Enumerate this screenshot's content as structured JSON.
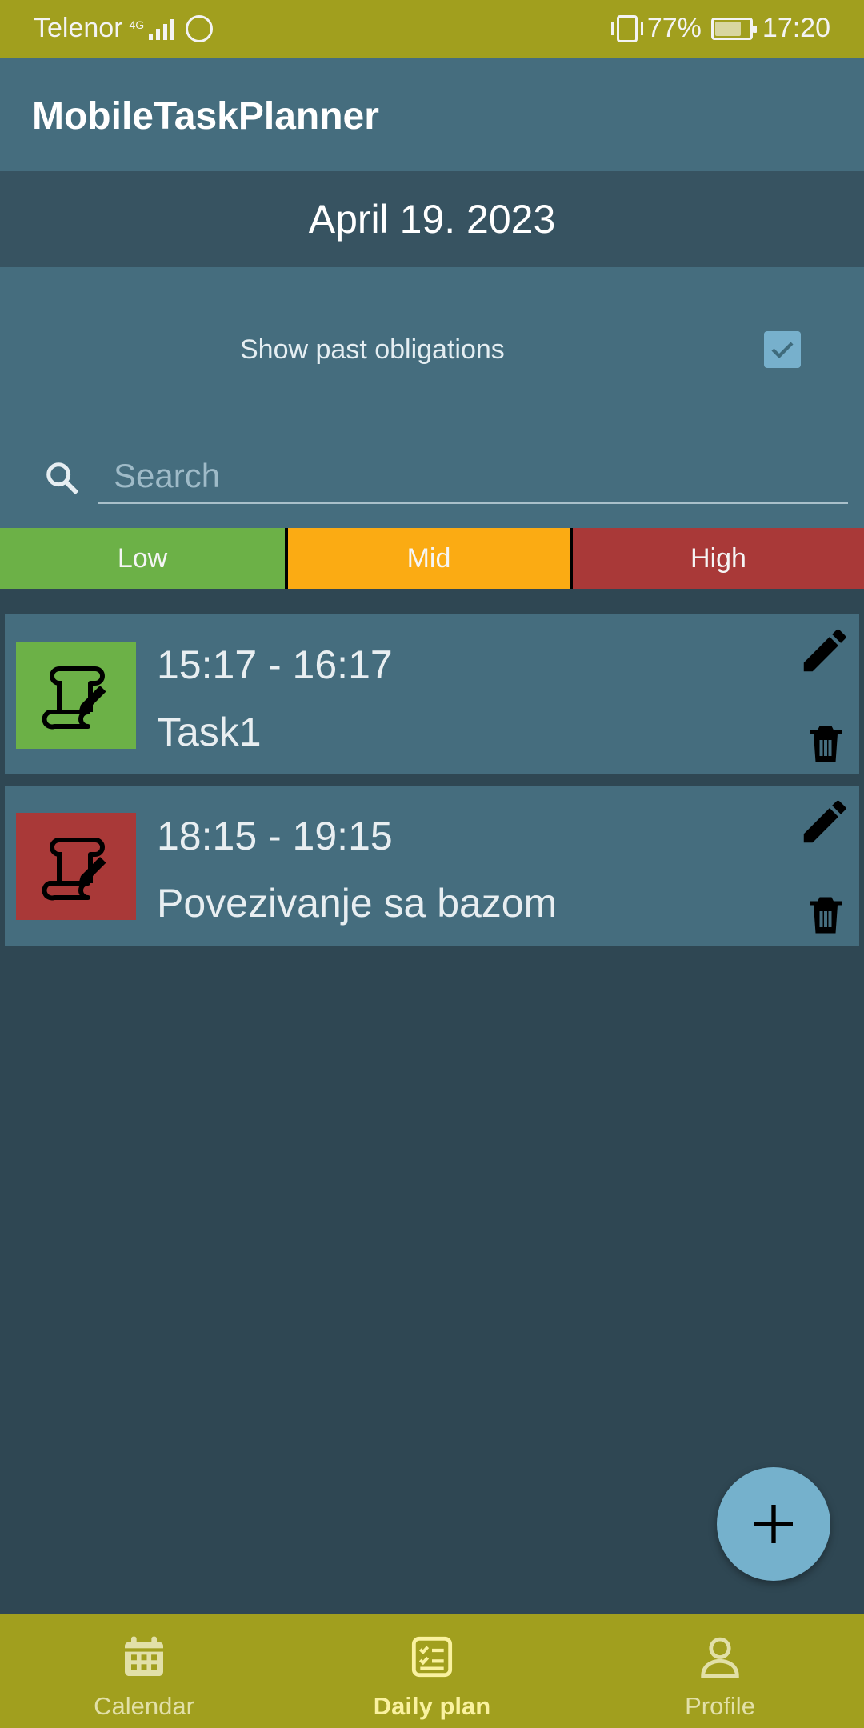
{
  "status_bar": {
    "carrier": "Telenor",
    "network": "4G",
    "battery_percent": "77%",
    "battery_level": 0.77,
    "time": "17:20"
  },
  "app": {
    "title": "MobileTaskPlanner",
    "date": "April 19. 2023"
  },
  "filters": {
    "show_past_label": "Show past obligations",
    "show_past_checked": true,
    "search_placeholder": "Search",
    "search_value": "",
    "priorities": [
      {
        "label": "Low",
        "color": "#6cb147"
      },
      {
        "label": "Mid",
        "color": "#fbab13"
      },
      {
        "label": "High",
        "color": "#a93938"
      }
    ]
  },
  "tasks": [
    {
      "time": "15:17 - 16:17",
      "name": "Task1",
      "priority_color": "#6cb147",
      "icon": "scroll-icon"
    },
    {
      "time": "18:15 - 19:15",
      "name": "Povezivanje sa bazom",
      "priority_color": "#a93938",
      "icon": "scroll-icon"
    }
  ],
  "fab": {
    "icon": "plus-icon"
  },
  "bottom_nav": {
    "items": [
      {
        "label": "Calendar",
        "icon": "calendar-icon",
        "active": false
      },
      {
        "label": "Daily plan",
        "icon": "checklist-icon",
        "active": true
      },
      {
        "label": "Profile",
        "icon": "person-icon",
        "active": false
      }
    ]
  },
  "colors": {
    "status_bar": "#a19f1e",
    "app_bar": "#456d7e",
    "background": "#2f4753",
    "accent": "#75b1cc"
  }
}
